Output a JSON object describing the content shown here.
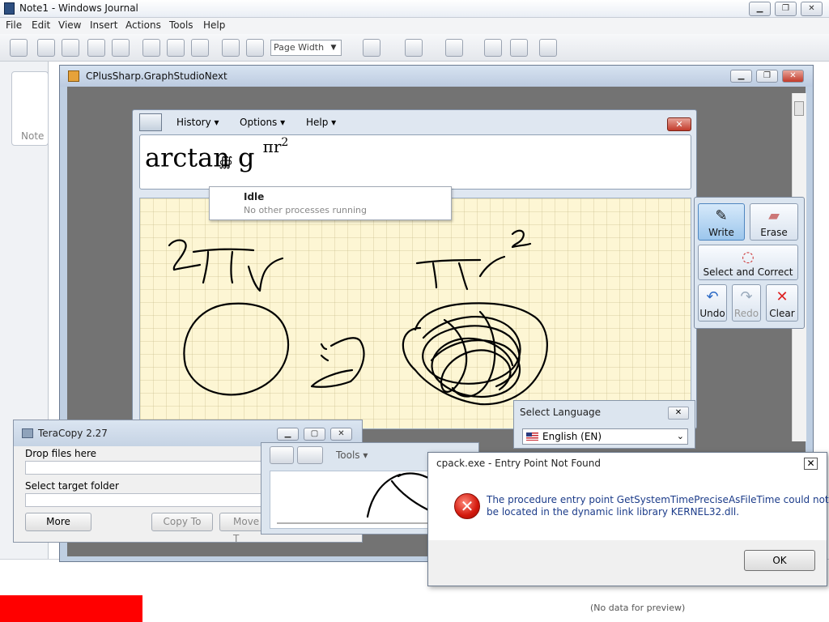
{
  "journal": {
    "title": "Note1 - Windows Journal",
    "menu": [
      "File",
      "Edit",
      "View",
      "Insert",
      "Actions",
      "Tools",
      "Help"
    ],
    "zoom": "Page Width",
    "note_thumb_label": "Note",
    "preview_empty": "(No data for preview)",
    "controls": [
      "minimize",
      "restore",
      "close"
    ]
  },
  "graphstudio": {
    "title": "CPlusSharp.GraphStudioNext"
  },
  "math_input": {
    "menu": {
      "history": "History ▾",
      "options": "Options ▾",
      "help": "Help ▾"
    },
    "formula_text": "arctan g",
    "formula_sup": "πr",
    "formula_sup2": "2",
    "formula_sub": "∰",
    "tools": {
      "write": "Write",
      "erase": "Erase",
      "select_correct": "Select and Correct",
      "undo": "Undo",
      "redo": "Redo",
      "clear": "Clear"
    }
  },
  "status_popup": {
    "title": "Idle",
    "subtitle": "No other processes running"
  },
  "language": {
    "title": "Select Language",
    "selected": "English (EN)"
  },
  "teracopy": {
    "title": "TeraCopy 2.27",
    "drop_label": "Drop files here",
    "target_label": "Select target folder",
    "more": "More",
    "copy_to": "Copy To",
    "move_to": "Move T"
  },
  "pen_input": {
    "tools_label": "Tools ▾"
  },
  "error_dialog": {
    "title": "cpack.exe - Entry Point Not Found",
    "line1": "The procedure entry point GetSystemTimePreciseAsFileTime could not",
    "line2": "be located in the dynamic link library KERNEL32.dll.",
    "ok": "OK"
  },
  "colors": {
    "error_red": "#d3180c",
    "pad_yellow": "#fdf6d4",
    "bottom_red": "#ff0000"
  }
}
